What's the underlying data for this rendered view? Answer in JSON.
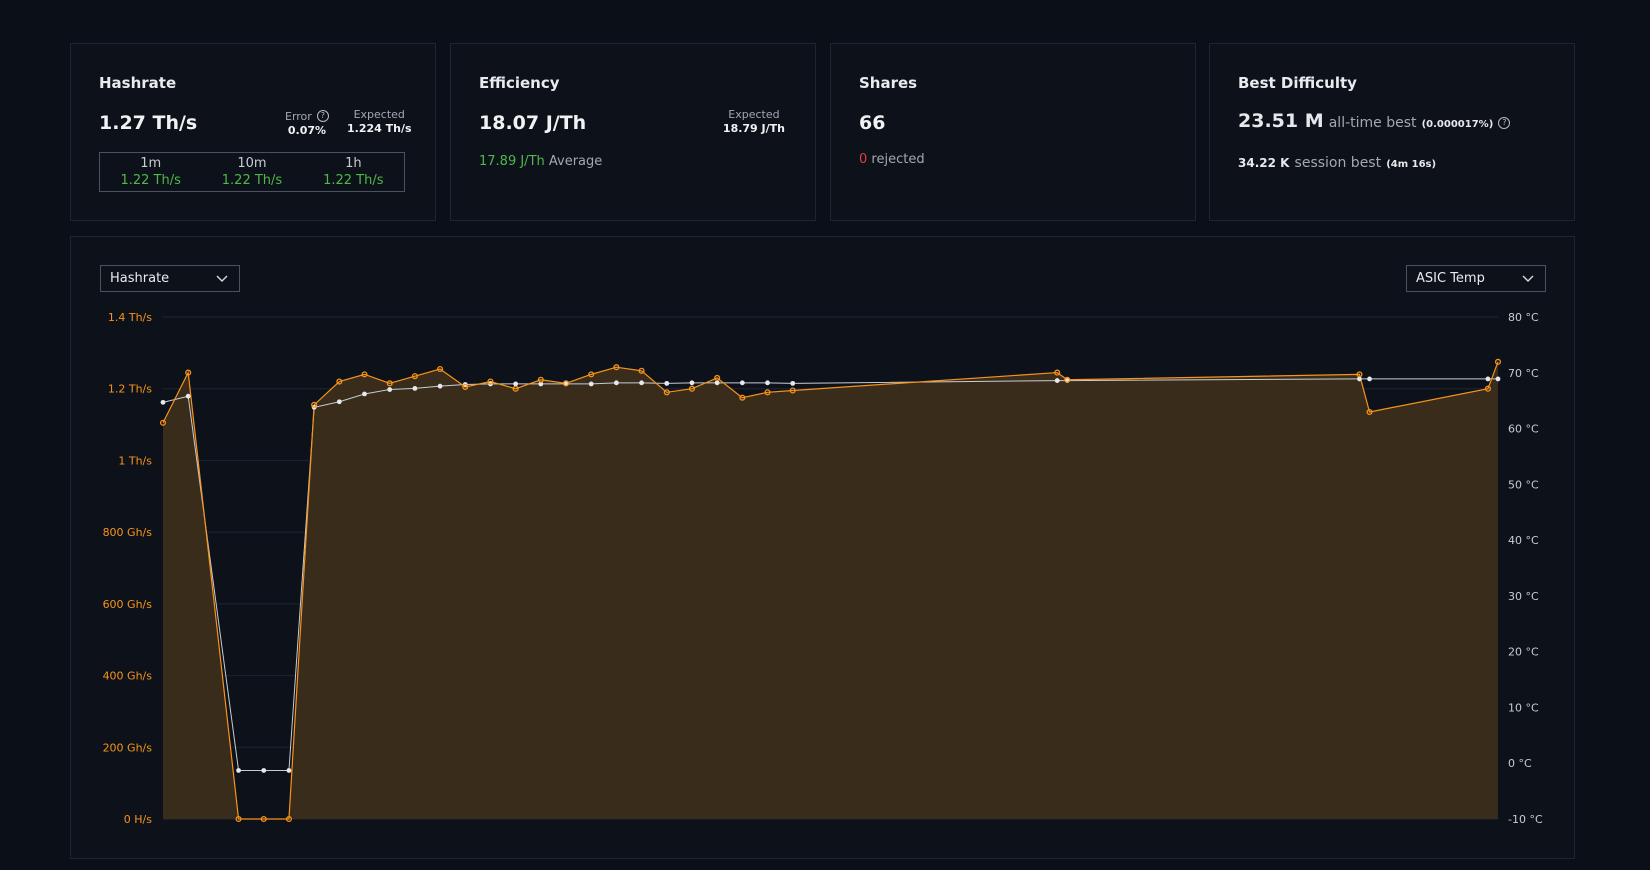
{
  "cards": {
    "hashrate": {
      "title": "Hashrate",
      "value": "1.27 Th/s",
      "error_label": "Error",
      "error_value": "0.07%",
      "expected_label": "Expected",
      "expected_value": "1.224 Th/s",
      "windows": [
        {
          "label": "1m",
          "value": "1.22 Th/s"
        },
        {
          "label": "10m",
          "value": "1.22 Th/s"
        },
        {
          "label": "1h",
          "value": "1.22 Th/s"
        }
      ]
    },
    "efficiency": {
      "title": "Efficiency",
      "value": "18.07 J/Th",
      "expected_label": "Expected",
      "expected_value": "18.79 J/Th",
      "average_value": "17.89 J/Th",
      "average_label": "Average"
    },
    "shares": {
      "title": "Shares",
      "value": "66",
      "rejected_count": "0",
      "rejected_label": "rejected"
    },
    "best_difficulty": {
      "title": "Best Difficulty",
      "alltime_value": "23.51 M",
      "alltime_label": "all-time best",
      "alltime_pct": "(0.000017%)",
      "session_value": "34.22 K",
      "session_label": "session best",
      "session_time": "(4m 16s)"
    }
  },
  "chart_controls": {
    "left_select": "Hashrate",
    "right_select": "ASIC Temp"
  },
  "colors": {
    "hashrate": "#f7931a",
    "temp": "#c8ccd2",
    "background": "#0b1018",
    "green": "#4fb848",
    "red": "#e43b3b"
  },
  "chart_data": {
    "type": "line",
    "left_axis": {
      "unit": "Th/s",
      "range": [
        0,
        1.4
      ],
      "ticks": [
        {
          "v": 1.4,
          "label": "1.4 Th/s"
        },
        {
          "v": 1.2,
          "label": "1.2 Th/s"
        },
        {
          "v": 1.0,
          "label": "1 Th/s"
        },
        {
          "v": 0.8,
          "label": "800 Gh/s"
        },
        {
          "v": 0.6,
          "label": "600 Gh/s"
        },
        {
          "v": 0.4,
          "label": "400 Gh/s"
        },
        {
          "v": 0.2,
          "label": "200 Gh/s"
        },
        {
          "v": 0.0,
          "label": "0 H/s"
        }
      ]
    },
    "right_axis": {
      "unit": "°C",
      "range": [
        -10,
        80
      ],
      "ticks": [
        {
          "v": 80,
          "label": "80 °C"
        },
        {
          "v": 70,
          "label": "70 °C"
        },
        {
          "v": 60,
          "label": "60 °C"
        },
        {
          "v": 50,
          "label": "50 °C"
        },
        {
          "v": 40,
          "label": "40 °C"
        },
        {
          "v": 30,
          "label": "30 °C"
        },
        {
          "v": 20,
          "label": "20 °C"
        },
        {
          "v": 10,
          "label": "10 °C"
        },
        {
          "v": 0,
          "label": "0 °C"
        },
        {
          "v": -10,
          "label": "-10 °C"
        }
      ]
    },
    "grid": true,
    "series": [
      {
        "name": "Hashrate",
        "axis": "left",
        "area": true,
        "points": [
          [
            0,
            1.105
          ],
          [
            1,
            1.245
          ],
          [
            3,
            0.0
          ],
          [
            4,
            0.0
          ],
          [
            5,
            0.0
          ],
          [
            6,
            1.155
          ],
          [
            7,
            1.22
          ],
          [
            8,
            1.24
          ],
          [
            9,
            1.215
          ],
          [
            10,
            1.235
          ],
          [
            11,
            1.255
          ],
          [
            12,
            1.205
          ],
          [
            13,
            1.22
          ],
          [
            14,
            1.2
          ],
          [
            15,
            1.225
          ],
          [
            16,
            1.215
          ],
          [
            17,
            1.24
          ],
          [
            18,
            1.26
          ],
          [
            19,
            1.25
          ],
          [
            20,
            1.19
          ],
          [
            21,
            1.2
          ],
          [
            22,
            1.23
          ],
          [
            23,
            1.175
          ],
          [
            24,
            1.19
          ],
          [
            25,
            1.195
          ],
          [
            35.5,
            1.245
          ],
          [
            35.9,
            1.225
          ],
          [
            47.5,
            1.24
          ],
          [
            47.9,
            1.135
          ],
          [
            52.6,
            1.2
          ],
          [
            53,
            1.275
          ]
        ]
      },
      {
        "name": "ASIC Temp",
        "axis": "right",
        "area": false,
        "points": [
          [
            0,
            64.7
          ],
          [
            1,
            65.8
          ],
          [
            3,
            -1.3
          ],
          [
            4,
            -1.3
          ],
          [
            5,
            -1.3
          ],
          [
            6,
            63.8
          ],
          [
            7,
            64.8
          ],
          [
            8,
            66.2
          ],
          [
            9,
            67
          ],
          [
            10,
            67.2
          ],
          [
            11,
            67.6
          ],
          [
            12,
            67.9
          ],
          [
            13,
            68
          ],
          [
            14,
            68
          ],
          [
            15,
            68
          ],
          [
            16,
            68
          ],
          [
            17,
            68
          ],
          [
            18,
            68.2
          ],
          [
            19,
            68.2
          ],
          [
            20,
            68.1
          ],
          [
            21,
            68.2
          ],
          [
            22,
            68.2
          ],
          [
            23,
            68.2
          ],
          [
            24,
            68.2
          ],
          [
            25,
            68.1
          ],
          [
            35.5,
            68.6
          ],
          [
            35.9,
            68.6
          ],
          [
            47.5,
            68.9
          ],
          [
            47.9,
            68.9
          ],
          [
            52.6,
            68.9
          ],
          [
            53,
            68.9
          ]
        ]
      }
    ]
  }
}
